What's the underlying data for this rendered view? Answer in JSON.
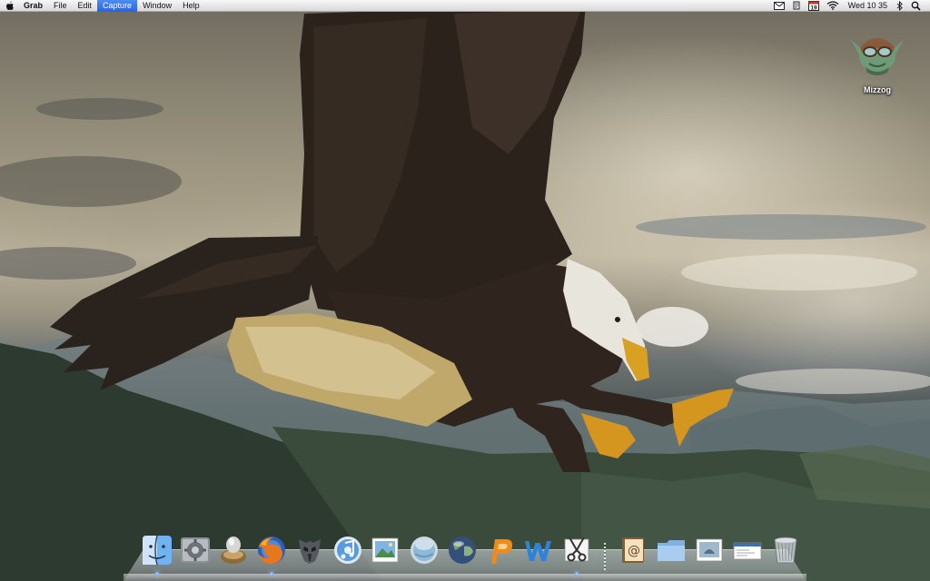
{
  "menubar": {
    "apple_icon": "apple-logo-icon",
    "app_name": "Grab",
    "menus": [
      {
        "label": "File",
        "active": false
      },
      {
        "label": "Edit",
        "active": false
      },
      {
        "label": "Capture",
        "active": true
      },
      {
        "label": "Window",
        "active": false
      },
      {
        "label": "Help",
        "active": false
      }
    ],
    "status": {
      "icons": [
        "mail-icon",
        "script-icon",
        "calendar-icon",
        "wifi-icon",
        "bluetooth-icon",
        "spotlight-search-icon"
      ],
      "calendar_day": "19",
      "clock": "Wed 10 35"
    },
    "active_color": "#2a6ae0"
  },
  "desktop": {
    "wallpaper": "bald-eagle-over-mountains",
    "icons": [
      {
        "label": "Mizzog",
        "icon": "goblin-aviator-icon"
      }
    ]
  },
  "dock": {
    "apps": [
      {
        "icon": "finder-icon",
        "running": true
      },
      {
        "icon": "system-preferences-icon",
        "running": false
      },
      {
        "icon": "growl-icon",
        "running": false
      },
      {
        "icon": "firefox-icon",
        "running": true
      },
      {
        "icon": "autobots-icon",
        "running": false
      },
      {
        "icon": "itunes-icon",
        "running": false
      },
      {
        "icon": "iphoto-icon",
        "running": false
      },
      {
        "icon": "time-machine-icon",
        "running": false
      },
      {
        "icon": "earth-globe-icon",
        "running": false
      },
      {
        "icon": "pages-p-icon",
        "running": false
      },
      {
        "icon": "wordpress-w-icon",
        "running": false
      },
      {
        "icon": "grab-icon",
        "running": true
      }
    ],
    "stacks": [
      {
        "icon": "address-book-icon"
      },
      {
        "icon": "documents-folder-icon"
      },
      {
        "icon": "photo-stack-icon"
      },
      {
        "icon": "mail-stack-icon"
      },
      {
        "icon": "trash-icon"
      }
    ]
  }
}
